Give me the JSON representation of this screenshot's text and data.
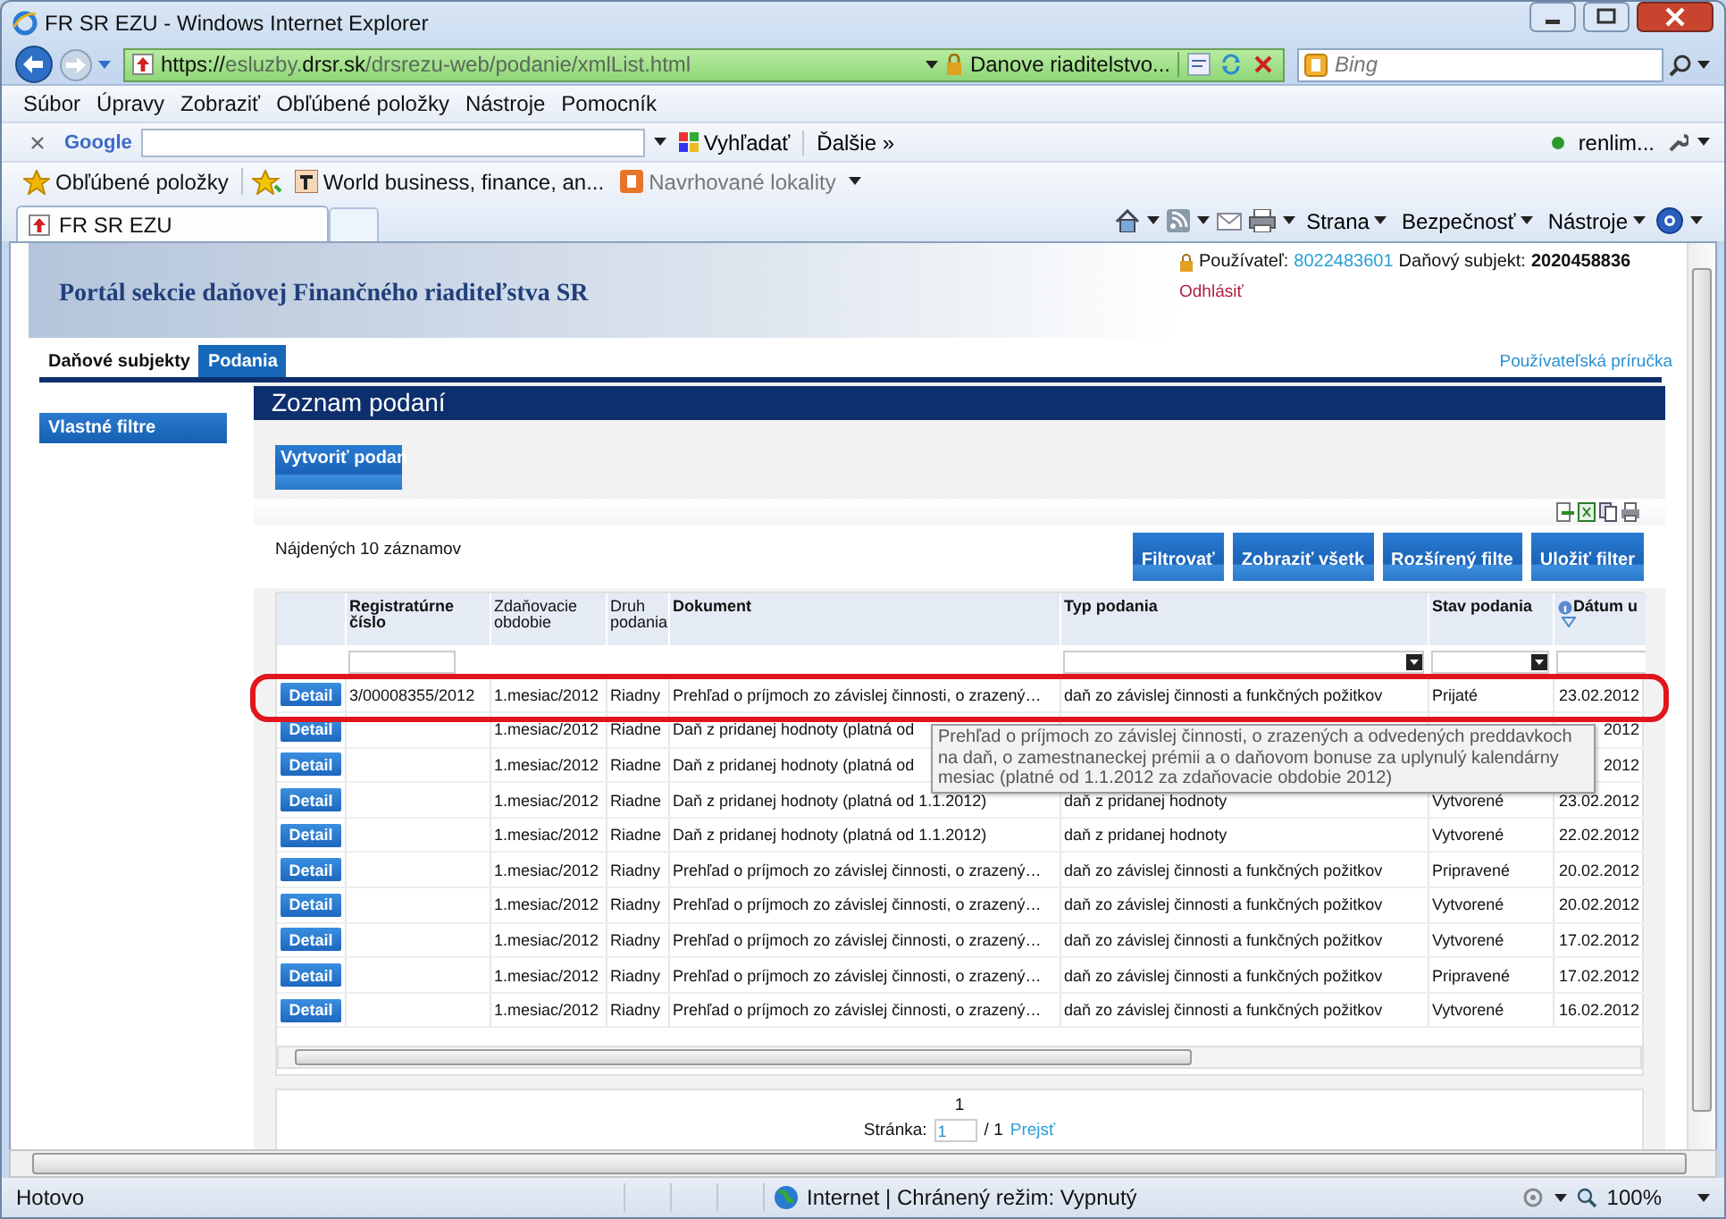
{
  "window": {
    "title": "FR SR EZU - Windows Internet Explorer"
  },
  "address_bar": {
    "url_parts": [
      {
        "text": "https://",
        "strong": true
      },
      {
        "text": "esluzby.",
        "strong": false
      },
      {
        "text": "drsr.sk",
        "strong": true
      },
      {
        "text": "/drsrezu-web/podanie/xmlList.html",
        "strong": false
      }
    ],
    "certificate": "Danove riaditelstvo...",
    "search_placeholder": "Bing"
  },
  "menu": [
    "Súbor",
    "Úpravy",
    "Zobraziť",
    "Obľúbené položky",
    "Nástroje",
    "Pomocník"
  ],
  "google_bar": {
    "brand": "Google",
    "search_button": "Vyhľadať",
    "more": "Ďalšie »",
    "account": "renlim..."
  },
  "favorites_bar": {
    "label": "Obľúbené položky",
    "items": [
      {
        "label": "World business, finance, an...",
        "disabled": false
      },
      {
        "label": "Navrhované lokality",
        "disabled": true
      }
    ]
  },
  "tabs": [
    {
      "label": "FR SR EZU",
      "selected": true
    }
  ],
  "command_bar": [
    "Strana",
    "Bezpečnosť",
    "Nástroje"
  ],
  "portal": {
    "title": "Portál sekcie daňovej Finančného riaditeľstva SR",
    "user_label": "Používateľ:",
    "user_id": "8022483601",
    "subject_label": "Daňový subjekt:",
    "subject_id": "2020458836",
    "logout": "Odhlásiť"
  },
  "nav_tabs": [
    {
      "label": "Daňové subjekty",
      "selected": false
    },
    {
      "label": "Podania",
      "selected": true
    }
  ],
  "help_link": "Používateľská príručka",
  "sidebar": {
    "items": [
      "Vlastné filtre"
    ]
  },
  "page_title": "Zoznam podaní",
  "create_button": "Vytvoriť podan",
  "results_count": "Nájdených 10 záznamov",
  "filter_buttons": [
    "Filtrovať",
    "Zobraziť všetk",
    "Rozšírený filte",
    "Uložiť filter"
  ],
  "table": {
    "columns": [
      {
        "label": "Registratúrne číslo",
        "sortable": true,
        "sorted": false,
        "filter": {
          "kind": "text"
        }
      },
      {
        "label": "Zdaňovacie obdobie",
        "sortable": false,
        "sorted": false
      },
      {
        "label": "Druh podania",
        "sortable": false,
        "sorted": false
      },
      {
        "label": "Dokument",
        "sortable": true,
        "sorted": false
      },
      {
        "label": "Typ podania",
        "sortable": true,
        "sorted": false,
        "filter": {
          "kind": "select"
        }
      },
      {
        "label": "Stav podania",
        "sortable": true,
        "sorted": false,
        "filter": {
          "kind": "select"
        }
      },
      {
        "label": "Dátum u",
        "sortable": true,
        "sorted": true,
        "filter": {
          "kind": "text"
        }
      }
    ],
    "rows": [
      {
        "action": "Detail",
        "highlighted": true,
        "tooltip": "Prehľad o príjmoch zo závislej činnosti, o zrazených a odvedených preddavkoch na daň, o zamestnaneckej prémii a o daňovom bonuse za uplynulý kalendárny mesiac (platné od 1.1.2012 za zdaňovacie obdobie 2012)",
        "cells": [
          "3/00008355/2012",
          "1.mesiac/2012",
          "Riadny",
          "Prehľad o príjmoch zo závislej činnosti, o zrazený…",
          "daň zo závislej činnosti a funkčných požitkov",
          "Prijaté",
          "23.02.2012"
        ]
      },
      {
        "action": "Detail",
        "highlighted": false,
        "cells": [
          "",
          "1.mesiac/2012",
          "Riadne",
          "Daň z pridanej hodnoty (platná od",
          "",
          "",
          "2012"
        ]
      },
      {
        "action": "Detail",
        "highlighted": false,
        "cells": [
          "",
          "1.mesiac/2012",
          "Riadne",
          "Daň z pridanej hodnoty (platná od",
          "",
          "",
          "2012"
        ]
      },
      {
        "action": "Detail",
        "highlighted": false,
        "cells": [
          "",
          "1.mesiac/2012",
          "Riadne",
          "Daň z pridanej hodnoty (platná od 1.1.2012)",
          "daň z pridanej hodnoty",
          "Vytvorené",
          "23.02.2012"
        ]
      },
      {
        "action": "Detail",
        "highlighted": false,
        "cells": [
          "",
          "1.mesiac/2012",
          "Riadne",
          "Daň z pridanej hodnoty (platná od 1.1.2012)",
          "daň z pridanej hodnoty",
          "Vytvorené",
          "22.02.2012"
        ]
      },
      {
        "action": "Detail",
        "highlighted": false,
        "cells": [
          "",
          "1.mesiac/2012",
          "Riadny",
          "Prehľad o príjmoch zo závislej činnosti, o zrazený…",
          "daň zo závislej činnosti a funkčných požitkov",
          "Pripravené",
          "20.02.2012"
        ]
      },
      {
        "action": "Detail",
        "highlighted": false,
        "cells": [
          "",
          "1.mesiac/2012",
          "Riadny",
          "Prehľad o príjmoch zo závislej činnosti, o zrazený…",
          "daň zo závislej činnosti a funkčných požitkov",
          "Vytvorené",
          "20.02.2012"
        ]
      },
      {
        "action": "Detail",
        "highlighted": false,
        "cells": [
          "",
          "1.mesiac/2012",
          "Riadny",
          "Prehľad o príjmoch zo závislej činnosti, o zrazený…",
          "daň zo závislej činnosti a funkčných požitkov",
          "Vytvorené",
          "17.02.2012"
        ]
      },
      {
        "action": "Detail",
        "highlighted": false,
        "cells": [
          "",
          "1.mesiac/2012",
          "Riadny",
          "Prehľad o príjmoch zo závislej činnosti, o zrazený…",
          "daň zo závislej činnosti a funkčných požitkov",
          "Pripravené",
          "17.02.2012"
        ]
      },
      {
        "action": "Detail",
        "highlighted": false,
        "cells": [
          "",
          "1.mesiac/2012",
          "Riadny",
          "Prehľad o príjmoch zo závislej činnosti, o zrazený…",
          "daň zo závislej činnosti a funkčných požitkov",
          "Vytvorené",
          "16.02.2012"
        ]
      }
    ]
  },
  "pagination": {
    "pages": "1",
    "label": "Stránka:",
    "value": "1",
    "total": "/ 1",
    "go": "Prejsť"
  },
  "status_bar": {
    "text": "Hotovo",
    "zone": "Internet | Chránený režim: Vypnutý",
    "zoom": "100%"
  }
}
